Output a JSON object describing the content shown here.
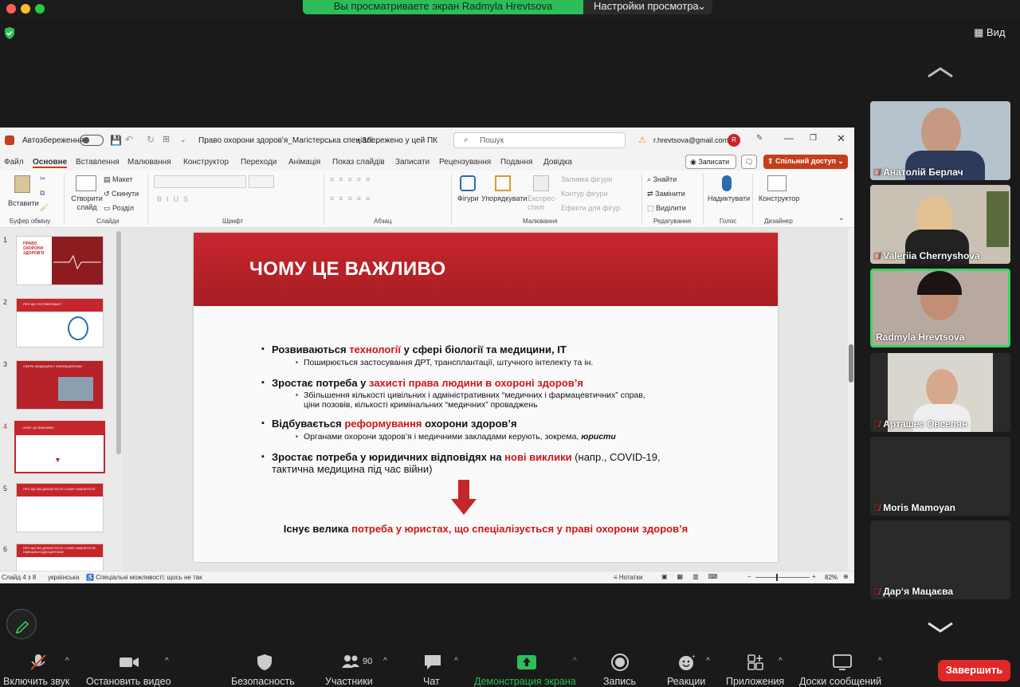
{
  "zoom_top": {
    "banner": "Вы просматриваете экран Radmyla Hrevtsova",
    "view_settings": "Настройки просмотра",
    "view_button": "Вид"
  },
  "ppt": {
    "autosave": "Автозбереження",
    "doc_title": "Право охорони здоров'я_Магістерська спеціалі...",
    "saved": "• Збережено у цей ПК",
    "search_placeholder": "Пошук",
    "account": "r.hrevtsova@gmail.com",
    "avatar": "R",
    "menu": [
      "Файл",
      "Основне",
      "Вставлення",
      "Малювання",
      "Конструктор",
      "Переходи",
      "Анімація",
      "Показ слайдів",
      "Записати",
      "Рецензування",
      "Подання",
      "Довідка"
    ],
    "record_btn": "Записати",
    "share_btn": "Спільний доступ",
    "ribbon": {
      "paste": "Вставити",
      "clipboard": "Буфер обміну",
      "new_slide": "Створити слайд",
      "layout": "Макет",
      "reset": "Скинути",
      "section": "Розділ",
      "slides": "Слайди",
      "font": "Шрифт",
      "paragraph": "Абзац",
      "shapes": "Фігури",
      "arrange": "Упорядкувати",
      "quick_styles": "Експрес-стилі",
      "shape_fill": "Заливка фігури",
      "shape_outline": "Контур фігури",
      "shape_effects": "Ефекти для фігур",
      "drawing": "Малювання",
      "find": "Знайти",
      "replace": "Замінити",
      "select": "Виділити",
      "editing": "Редагування",
      "dictate": "Надиктувати",
      "voice": "Голос",
      "designer": "Конструктор",
      "designer_group": "Дизайнер"
    },
    "thumbs": [
      {
        "num": "1",
        "title": "ПРАВО ОХОРОНИ ЗДОРОВ'Я"
      },
      {
        "num": "2",
        "title": "ПРО ЩО ПОГОВОРИМО?"
      },
      {
        "num": "3",
        "title": "СФЕРА МЕДИЦИНИ І ФАРМАЦЕВТИКИ"
      },
      {
        "num": "4",
        "title": "ЧОМУ ЦЕ ВАЖЛИВО"
      },
      {
        "num": "5",
        "title": "ПРО ЩО ВИ ДІЗНАЄТЕСЯ І ЧОМУ НАВЧИТЕСЯ"
      },
      {
        "num": "6",
        "title": "ПРО ЩО ВИ ДІЗНАЄТЕСЯ І ЧОМУ НАВЧИТЕСЯ: НАВЧАЛЬНІ ДИСЦИПЛІНИ"
      }
    ],
    "slide": {
      "title": "ЧОМУ ЦЕ ВАЖЛИВО",
      "b1a": "Розвиваються ",
      "b1b": "технології",
      "b1c": " у сфері біології та медицини, IT",
      "s1": "Поширюється застосування ДРТ, трансплантації, штучного інтелекту та ін.",
      "b2a": "Зростає потреба у ",
      "b2b": "захисті права людини в охороні здоров’я",
      "s2a": "Збільшення кількості цивільних і адміністративних “медичних і фармацевтичних” справ,",
      "s2b": "ціни позовів, кількості кримінальних “медичних” проваджень",
      "b3a": "Відбувається ",
      "b3b": "реформування",
      "b3c": " охорони здоров’я",
      "s3a": "Органами охорони здоров’я і медичними закладами керують, зокрема, ",
      "s3b": "юристи",
      "b4a": "Зростає потреба у ",
      "b4b": "юридичних відповідях на ",
      "b4c": "нові виклики",
      "b4d": " (напр., COVID-19,",
      "b4e": "тактична медицина під час війни)",
      "concl_a": "Існує велика ",
      "concl_b": "потреба у юристах, що спеціалізується у праві охорони здоров’я"
    },
    "status": {
      "slide": "Слайд 4 з 8",
      "lang": "українська",
      "access": "Спеціальні можливості: щось не так",
      "notes": "Нотатки",
      "zoom": "82%"
    }
  },
  "participants": [
    {
      "name": "Анатолій Берлач",
      "muted": true
    },
    {
      "name": "Valeriia Chernyshova",
      "muted": true
    },
    {
      "name": "Radmyla Hrevtsova",
      "muted": false
    },
    {
      "name": "Арташес Овсепян",
      "muted": true
    },
    {
      "name": "Moris Mamoyan",
      "muted": true
    },
    {
      "name": "Дар‘я Мацаєва",
      "muted": true
    }
  ],
  "toolbar": {
    "unmute": "Включить звук",
    "stop_video": "Остановить видео",
    "security": "Безопасность",
    "participants": "Участники",
    "participants_count": "90",
    "chat": "Чат",
    "share": "Демонстрация экрана",
    "record": "Запись",
    "reactions": "Реакции",
    "apps": "Приложения",
    "whiteboards": "Доски сообщений",
    "end": "Завершить"
  },
  "colors": {
    "accent_green": "#2dbe5a",
    "slide_red": "#c5262c",
    "end_red": "#e02828",
    "active_speaker": "#3cd464"
  }
}
